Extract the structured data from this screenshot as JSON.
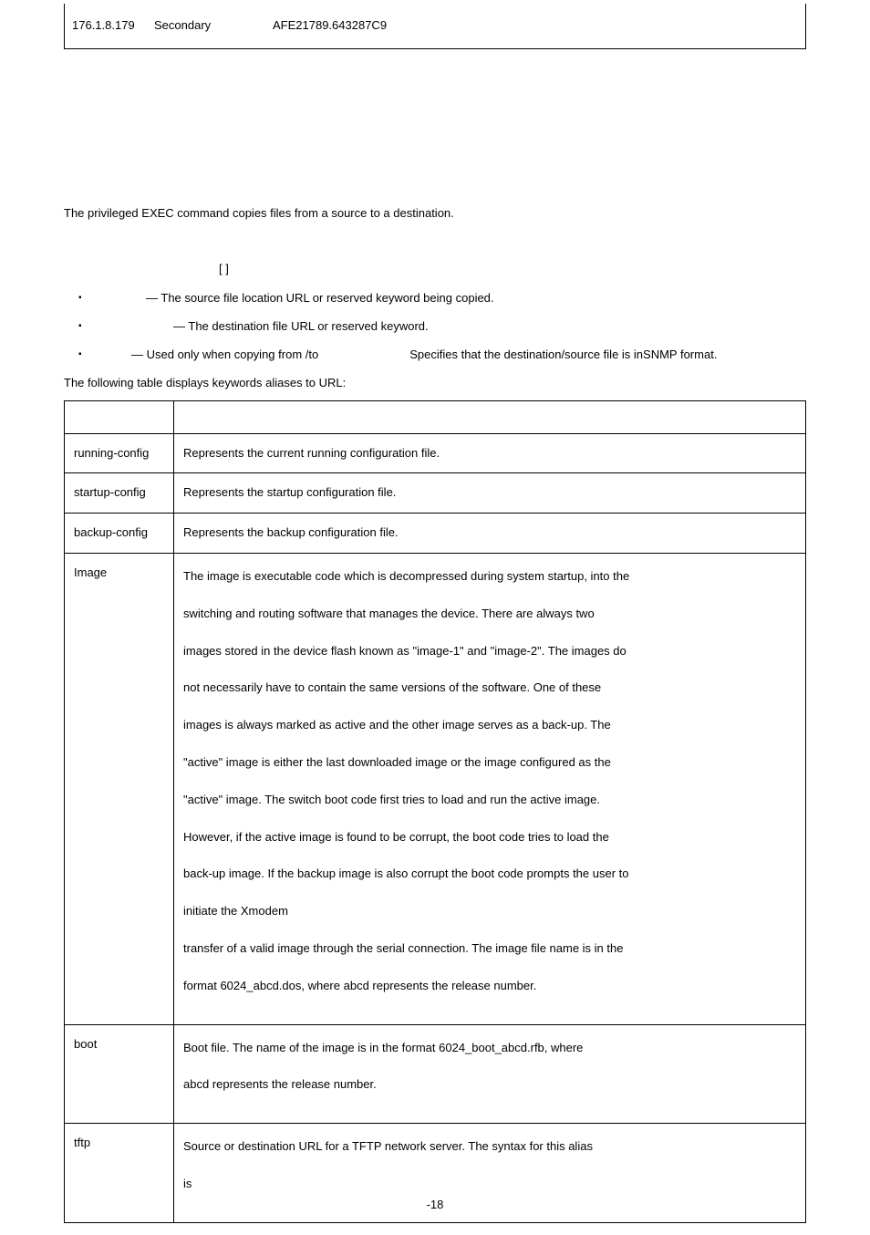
{
  "top_row": {
    "c1": "176.1.8.179",
    "c2": "Secondary",
    "c3": "AFE21789.643287C9"
  },
  "intro": {
    "prefix": "The ",
    "suffix": " privileged EXEC command copies files from a source to a destination."
  },
  "syntax": "[         ]",
  "params": {
    "p1_desc": "— The source file location URL or reserved keyword being copied.",
    "p2_desc": "— The destination file URL or reserved keyword.",
    "p3_desc": "— Used only when copying from /to",
    "p3_tail": "Specifies that the destination/source file is inSNMP format."
  },
  "table_intro": "The following table displays keywords aliases to URL:",
  "aliases": {
    "header": {
      "k": "",
      "d": ""
    },
    "rows": [
      {
        "k": "running-config",
        "d": "Represents the current running configuration file."
      },
      {
        "k": "startup-config",
        "d": "Represents the startup configuration file."
      },
      {
        "k": "backup-config",
        "d": "Represents the backup configuration file."
      },
      {
        "k": "Image",
        "d_list": [
          "The image is executable code which is decompressed during system startup, into the",
          "switching and routing software that manages the device. There are always two",
          "images stored in the device flash known as \"image-1\" and \"image-2\". The images do",
          "not necessarily have to contain the same versions of the software. One of these",
          "images is always marked as active and the other image serves as a back-up. The",
          "\"active\" image is either the last downloaded image or the image configured as the",
          "\"active\" image. The switch boot code first tries to load and run the active image.",
          "However, if the active image is found to be corrupt, the boot code tries to load the",
          "back-up image. If the backup image is also corrupt the boot code prompts the user to",
          "initiate the Xmodem",
          "transfer of a valid image through the serial connection. The image file name is in the",
          "format 6024_abcd.dos, where abcd represents the release number."
        ]
      },
      {
        "k": "boot",
        "d_list": [
          "Boot file. The name of the image is in the format 6024_boot_abcd.rfb, where",
          "abcd represents the release number."
        ]
      },
      {
        "k": "tftp",
        "d_list": [
          "Source or destination URL for a TFTP network server. The syntax for this alias",
          "is"
        ]
      }
    ]
  },
  "footer": "-18"
}
